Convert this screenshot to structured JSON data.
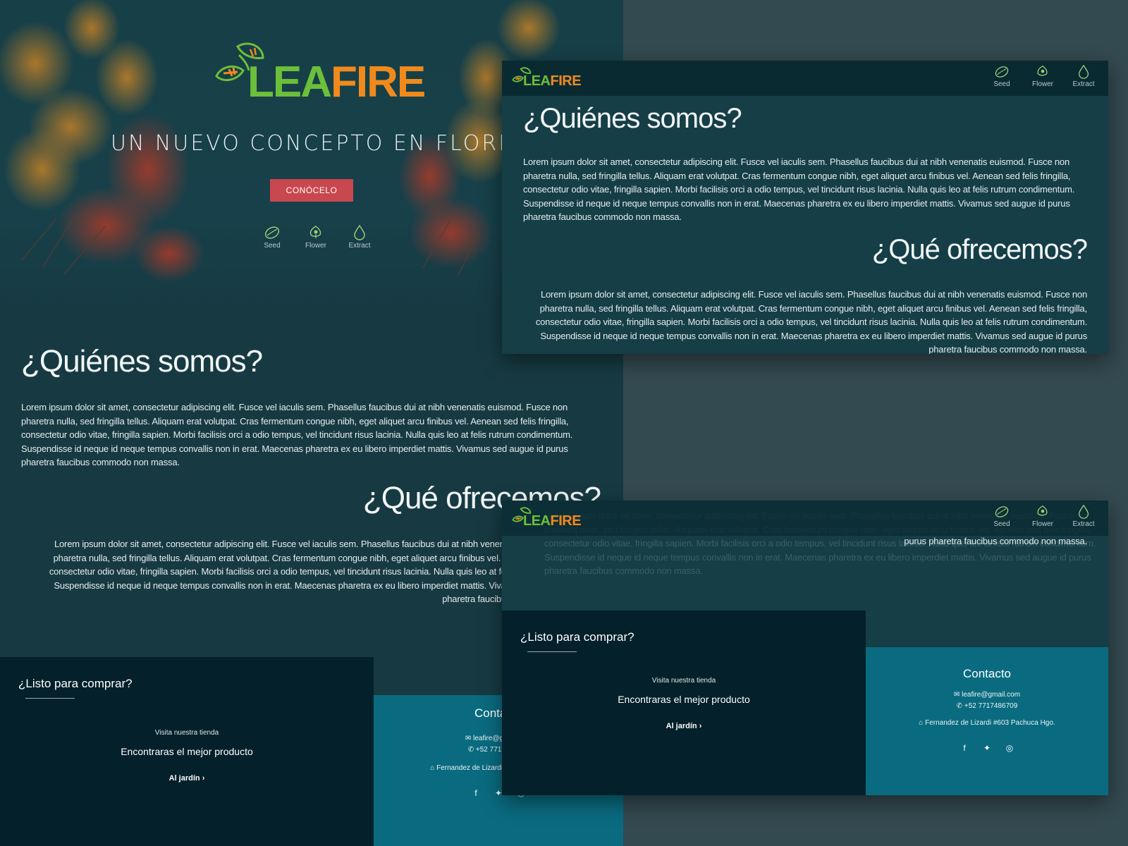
{
  "brand": {
    "logo_leaf": "LEA",
    "logo_fire": "FIRE",
    "leaf_color": "#6cbf3a",
    "fire_color": "#f08a1c"
  },
  "hero": {
    "tagline": "UN NUEVO CONCEPTO EN FLORES",
    "cta_label": "CONÓCELO",
    "cta_color": "#c9474e"
  },
  "categories": [
    {
      "label": "Seed",
      "icon": "seed-icon"
    },
    {
      "label": "Flower",
      "icon": "flower-icon"
    },
    {
      "label": "Extract",
      "icon": "extract-icon"
    }
  ],
  "about": {
    "title": "¿Quiénes somos?",
    "text": "Lorem ipsum dolor sit amet, consectetur adipiscing elit. Fusce vel iaculis sem. Phasellus faucibus dui at nibh venenatis euismod. Fusce non pharetra nulla, sed fringilla tellus. Aliquam erat volutpat. Cras fermentum congue nibh, eget aliquet arcu finibus vel. Aenean sed felis fringilla, consectetur odio vitae, fringilla sapien. Morbi facilisis orci a odio tempus, vel tincidunt risus lacinia. Nulla quis leo at felis rutrum condimentum. Suspendisse id neque id neque tempus convallis non in erat. Maecenas pharetra ex eu libero imperdiet mattis. Vivamus sed augue id purus pharetra faucibus commodo non massa."
  },
  "offer": {
    "title": "¿Qué ofrecemos?",
    "text": "Lorem ipsum dolor sit amet, consectetur adipiscing elit. Fusce vel iaculis sem. Phasellus faucibus dui at nibh venenatis euismod. Fusce non pharetra nulla, sed fringilla tellus. Aliquam erat volutpat. Cras fermentum congue nibh, eget aliquet arcu finibus vel. Aenean sed felis fringilla, consectetur odio vitae, fringilla sapien. Morbi facilisis orci a odio tempus, vel tincidunt risus lacinia. Nulla quis leo at felis rutrum condimentum. Suspendisse id neque id neque tempus convallis non in erat. Maecenas pharetra ex eu libero imperdiet mattis. Vivamus sed augue id purus pharetra faucibus commodo non massa.",
    "tail": "purus pharetra faucibus commodo non massa."
  },
  "buy": {
    "title": "¿Listo para comprar?",
    "small": "Visita nuestra tienda",
    "main": "Encontraras el mejor producto",
    "link": "Al jardín"
  },
  "contact": {
    "title": "Contacto",
    "email": "leafire@gmail.com",
    "phone": "+52 7717486709",
    "address": "Fernandez de Lizardi #603 Pachuca Hgo."
  },
  "colors": {
    "page_bg": "#173a42",
    "footer_dark": "#04202a",
    "footer_teal": "#0a6b80",
    "navbar": "#0a2a32"
  }
}
